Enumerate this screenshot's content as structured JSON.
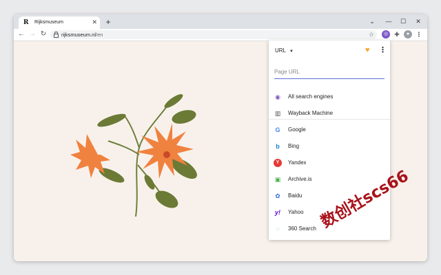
{
  "tab": {
    "title": "Rijksmuseum",
    "favicon": "R"
  },
  "toolbar": {
    "url_host": "rijksmuseum.nl",
    "url_path": "/en"
  },
  "popup": {
    "mode_label": "URL",
    "url_placeholder": "Page URL",
    "engines": [
      {
        "name": "All search engines",
        "icon": "globe-icon",
        "color": "#7e57c2"
      },
      {
        "name": "Wayback Machine",
        "icon": "wayback-icon",
        "color": "#555555"
      },
      {
        "name": "Google",
        "icon": "google-icon",
        "color": "#4285f4"
      },
      {
        "name": "Bing",
        "icon": "bing-icon",
        "color": "#0a7cd6"
      },
      {
        "name": "Yandex",
        "icon": "yandex-icon",
        "color": "#e53935"
      },
      {
        "name": "Archive.is",
        "icon": "archive-icon",
        "color": "#4caf50"
      },
      {
        "name": "Baidu",
        "icon": "baidu-icon",
        "color": "#2f6fd8"
      },
      {
        "name": "Yahoo",
        "icon": "yahoo-icon",
        "color": "#6001d2"
      },
      {
        "name": "360 Search",
        "icon": "360-icon",
        "color": "#35b44a"
      }
    ]
  },
  "watermark": "数创社scs66"
}
